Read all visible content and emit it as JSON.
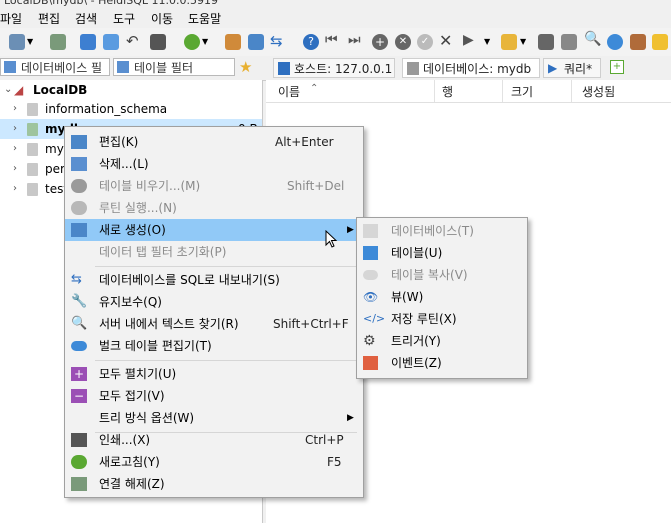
{
  "window": {
    "title": "LocalDB\\mydb\\ - HeidiSQL 11.0.0.5919"
  },
  "menubar": [
    "파일",
    "편집",
    "검색",
    "도구",
    "이동",
    "도움말"
  ],
  "filters": {
    "db_filter": "데이터베이스 필터",
    "table_filter": "테이블 필터"
  },
  "tabs": {
    "host": "호스트: 127.0.0.1",
    "database": "데이터베이스: mydb",
    "query": "쿼리*"
  },
  "tree": {
    "root": "LocalDB",
    "items": [
      {
        "label": "information_schema"
      },
      {
        "label": "mydb",
        "size": "0 B"
      },
      {
        "label": "my"
      },
      {
        "label": "per"
      },
      {
        "label": "test"
      }
    ]
  },
  "list_columns": [
    "이름",
    "행",
    "크기",
    "생성됨"
  ],
  "context_menu": [
    {
      "label": "편집(K)",
      "shortcut": "Alt+Enter",
      "disabled": false
    },
    {
      "label": "삭제...(L)",
      "shortcut": "",
      "disabled": false
    },
    {
      "label": "테이블 비우기...(M)",
      "shortcut": "Shift+Del",
      "disabled": true
    },
    {
      "label": "루틴 실행...(N)",
      "shortcut": "",
      "disabled": true
    },
    {
      "label": "새로 생성(O)",
      "shortcut": "",
      "disabled": false,
      "highlighted": true,
      "submenu": true
    },
    {
      "label": "데이터 탭 필터 초기화(P)",
      "shortcut": "",
      "disabled": true
    },
    {
      "label": "데이터베이스를 SQL로 내보내기(S)",
      "shortcut": "",
      "disabled": false
    },
    {
      "label": "유지보수(Q)",
      "shortcut": "",
      "disabled": false
    },
    {
      "label": "서버 내에서 텍스트 찾기(R)",
      "shortcut": "Shift+Ctrl+F",
      "disabled": false
    },
    {
      "label": "벌크 테이블 편집기(T)",
      "shortcut": "",
      "disabled": false
    },
    {
      "label": "모두 펼치기(U)",
      "shortcut": "",
      "disabled": false
    },
    {
      "label": "모두 접기(V)",
      "shortcut": "",
      "disabled": false
    },
    {
      "label": "트리 방식 옵션(W)",
      "shortcut": "",
      "disabled": false,
      "submenu": true
    },
    {
      "label": "인쇄...(X)",
      "shortcut": "Ctrl+P",
      "disabled": false
    },
    {
      "label": "새로고침(Y)",
      "shortcut": "F5",
      "disabled": false
    },
    {
      "label": "연결 해제(Z)",
      "shortcut": "",
      "disabled": false
    }
  ],
  "submenu": [
    {
      "label": "데이터베이스(T)",
      "disabled": true
    },
    {
      "label": "테이블(U)",
      "disabled": false
    },
    {
      "label": "테이블 복사(V)",
      "disabled": true
    },
    {
      "label": "뷰(W)",
      "disabled": false
    },
    {
      "label": "저장 루틴(X)",
      "disabled": false
    },
    {
      "label": "트리거(Y)",
      "disabled": false
    },
    {
      "label": "이벤트(Z)",
      "disabled": false
    }
  ],
  "colors": {
    "highlight": "#91c9f7",
    "accent_green": "#5aa832",
    "accent_blue": "#2e6fc0"
  }
}
